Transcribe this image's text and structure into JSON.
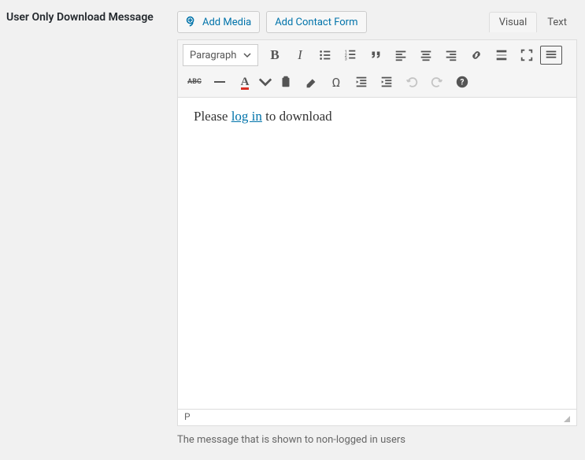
{
  "field": {
    "label": "User Only Download Message",
    "help": "The message that is shown to non-logged in users"
  },
  "buttons": {
    "add_media": "Add Media",
    "add_contact": "Add Contact Form"
  },
  "tabs": {
    "visual": "Visual",
    "text": "Text"
  },
  "toolbar": {
    "format_select": "Paragraph",
    "color_letter": "A",
    "strike_abbr": "ABC",
    "omega": "Ω"
  },
  "content": {
    "before": "Please ",
    "link": "log in",
    "after": " to download"
  },
  "status": {
    "path": "P"
  }
}
